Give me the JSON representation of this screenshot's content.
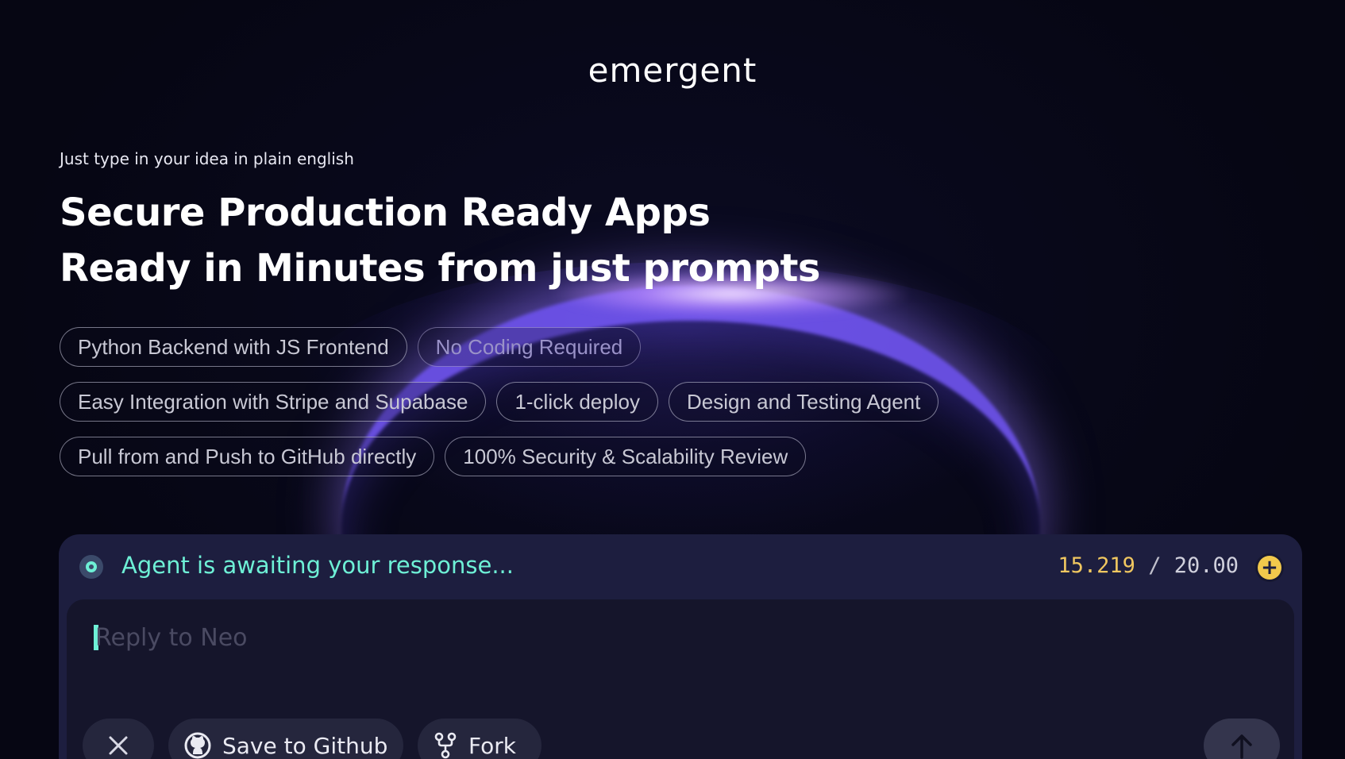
{
  "brand": {
    "logo_text": "emergent"
  },
  "hero": {
    "subheading": "Just type in your idea in plain english",
    "headline_line1": "Secure Production Ready Apps",
    "headline_line2": "Ready in Minutes from just prompts"
  },
  "features": {
    "row1": [
      "Python Backend with JS Frontend",
      "No Coding Required"
    ],
    "row2": [
      "Easy Integration with Stripe and Supabase",
      "1-click deploy",
      "Design and Testing Agent"
    ],
    "row3": [
      "Pull from and Push to GitHub directly",
      "100% Security & Scalability Review"
    ]
  },
  "chat": {
    "status_text": "Agent is awaiting your response...",
    "credits_used": "15.219",
    "credits_separator": "/",
    "credits_total": "20.00",
    "add_credits_icon": "plus-circle-icon",
    "reply_placeholder": "Reply to Neo",
    "reply_value": "",
    "actions": {
      "close_icon": "close-icon",
      "save_github_label": "Save to Github",
      "save_github_icon": "github-icon",
      "fork_label": "Fork",
      "fork_icon": "fork-icon",
      "send_icon": "arrow-up-icon"
    }
  },
  "colors": {
    "background": "#070716",
    "accent_teal": "#6ef0d6",
    "credits_gold": "#f0c760",
    "panel_bg": "#1d1e3f",
    "glow_purple": "#785aff"
  }
}
